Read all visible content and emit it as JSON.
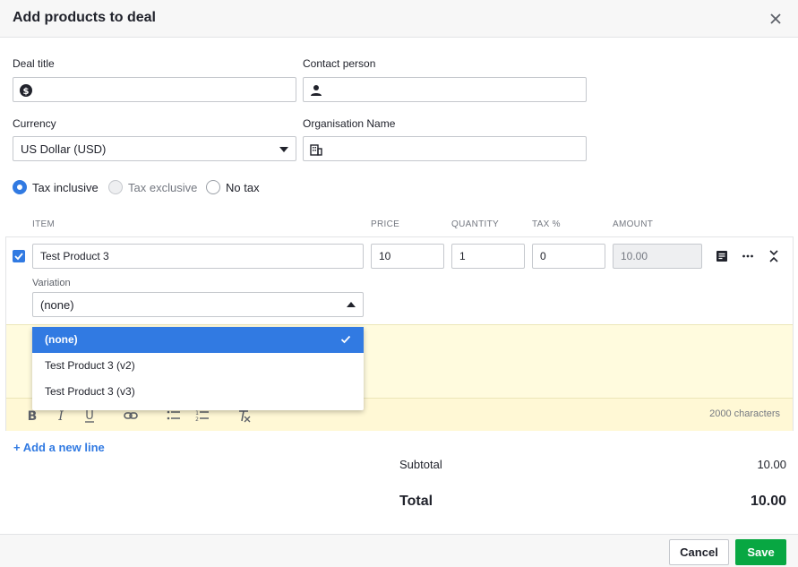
{
  "dialog": {
    "title": "Add products to deal"
  },
  "form": {
    "deal_title_label": "Deal title",
    "deal_title_value": "",
    "contact_label": "Contact person",
    "contact_value": "",
    "currency_label": "Currency",
    "currency_value": "US Dollar (USD)",
    "org_label": "Organisation Name",
    "org_value": ""
  },
  "tax": {
    "options": [
      {
        "label": "Tax inclusive",
        "selected": true,
        "disabled": false
      },
      {
        "label": "Tax exclusive",
        "selected": false,
        "disabled": true
      },
      {
        "label": "No tax",
        "selected": false,
        "disabled": false
      }
    ]
  },
  "table": {
    "headers": {
      "item": "ITEM",
      "price": "PRICE",
      "quantity": "QUANTITY",
      "tax": "TAX %",
      "amount": "AMOUNT"
    },
    "row": {
      "checked": true,
      "item": "Test Product 3",
      "price": "10",
      "quantity": "1",
      "tax": "0",
      "amount": "10.00",
      "variation_label": "Variation",
      "variation_value": "(none)"
    }
  },
  "variation_options": [
    {
      "label": "(none)",
      "selected": true
    },
    {
      "label": "Test Product 3 (v2)",
      "selected": false
    },
    {
      "label": "Test Product 3 (v3)",
      "selected": false
    }
  ],
  "notes": {
    "chars_left": "2000 characters"
  },
  "add_line": "+ Add a new line",
  "summary": {
    "subtotal_label": "Subtotal",
    "subtotal_value": "10.00",
    "total_label": "Total",
    "total_value": "10.00"
  },
  "footer": {
    "cancel": "Cancel",
    "save": "Save"
  },
  "colors": {
    "accent": "#317ae2",
    "save": "#08a742",
    "notes_bg": "#fffbde"
  },
  "icons": [
    "close-icon",
    "dollar-icon",
    "person-icon",
    "building-icon",
    "note-icon",
    "more-icon",
    "collapse-icon",
    "check-icon",
    "bold-icon",
    "italic-icon",
    "underline-icon",
    "link-icon",
    "bullet-list-icon",
    "numbered-list-icon",
    "clear-format-icon"
  ]
}
